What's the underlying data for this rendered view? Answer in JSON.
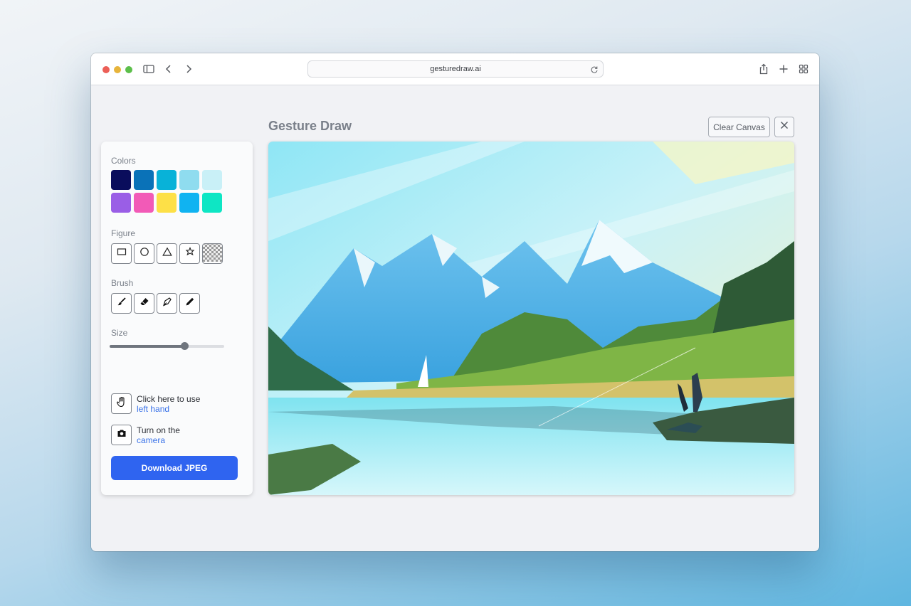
{
  "browser": {
    "url": "gesturedraw.ai",
    "traffic_lights": [
      "#ec5f57",
      "#e7b43b",
      "#5cbf4a"
    ]
  },
  "app": {
    "title": "Gesture Draw",
    "clear_label": "Clear Canvas",
    "close_icon": "close-icon"
  },
  "panel": {
    "colors_label": "Colors",
    "colors": [
      "#0a0d5c",
      "#0a72b8",
      "#08b2d8",
      "#8fdcef",
      "#c9f0f7",
      "#9a5ee6",
      "#f25ab7",
      "#fde047",
      "#10b3f1",
      "#0ee6c4"
    ],
    "figure_label": "Figure",
    "figures": [
      "rectangle-icon",
      "circle-icon",
      "triangle-icon",
      "star-icon",
      "transparent-icon"
    ],
    "brush_label": "Brush",
    "brushes": [
      "brush-icon",
      "eraser-icon",
      "pen-nib-icon",
      "pencil-icon"
    ],
    "size_label": "Size",
    "size_value": 0.65,
    "left_hand": {
      "line1": "Click here to use",
      "link": "left hand"
    },
    "camera": {
      "line1": "Turn on the",
      "link": "camera"
    },
    "download_label": "Download JPEG"
  }
}
